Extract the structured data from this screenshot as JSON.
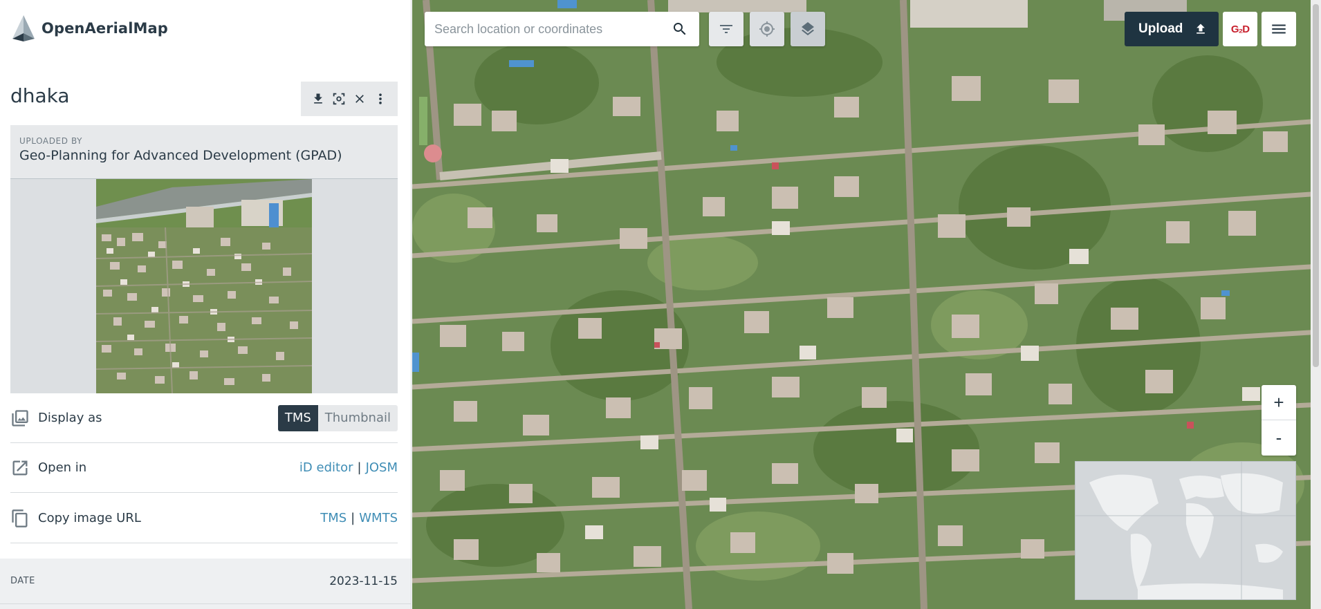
{
  "app": {
    "brand_name": "OpenAerialMap"
  },
  "image": {
    "title": "dhaka",
    "uploaded_by_label": "UPLOADED BY",
    "uploaded_by": "Geo-Planning for Advanced Development (GPAD)"
  },
  "actions": [
    {
      "icon": "download-icon"
    },
    {
      "icon": "focus-icon"
    },
    {
      "icon": "close-icon"
    },
    {
      "icon": "more-vertical-icon"
    }
  ],
  "display": {
    "label": "Display as",
    "options": [
      "TMS",
      "Thumbnail"
    ],
    "selected": "TMS"
  },
  "open_in": {
    "label": "Open in",
    "links": [
      "iD editor",
      "JOSM"
    ],
    "separator": "|"
  },
  "copy_url": {
    "label": "Copy image URL",
    "links": [
      "TMS",
      "WMTS"
    ],
    "separator": "|"
  },
  "meta": {
    "date_label": "DATE",
    "date_value": "2023-11-15"
  },
  "map": {
    "search_placeholder": "Search location or coordinates",
    "upload_label": "Upload",
    "gpad_logo_text": "G₂D",
    "zoom_in": "+",
    "zoom_out": "-"
  },
  "colors": {
    "dark": "#1f3441",
    "link": "#3f8db5",
    "panel": "#e7e9eb",
    "vegetation": "#6b8a52"
  }
}
